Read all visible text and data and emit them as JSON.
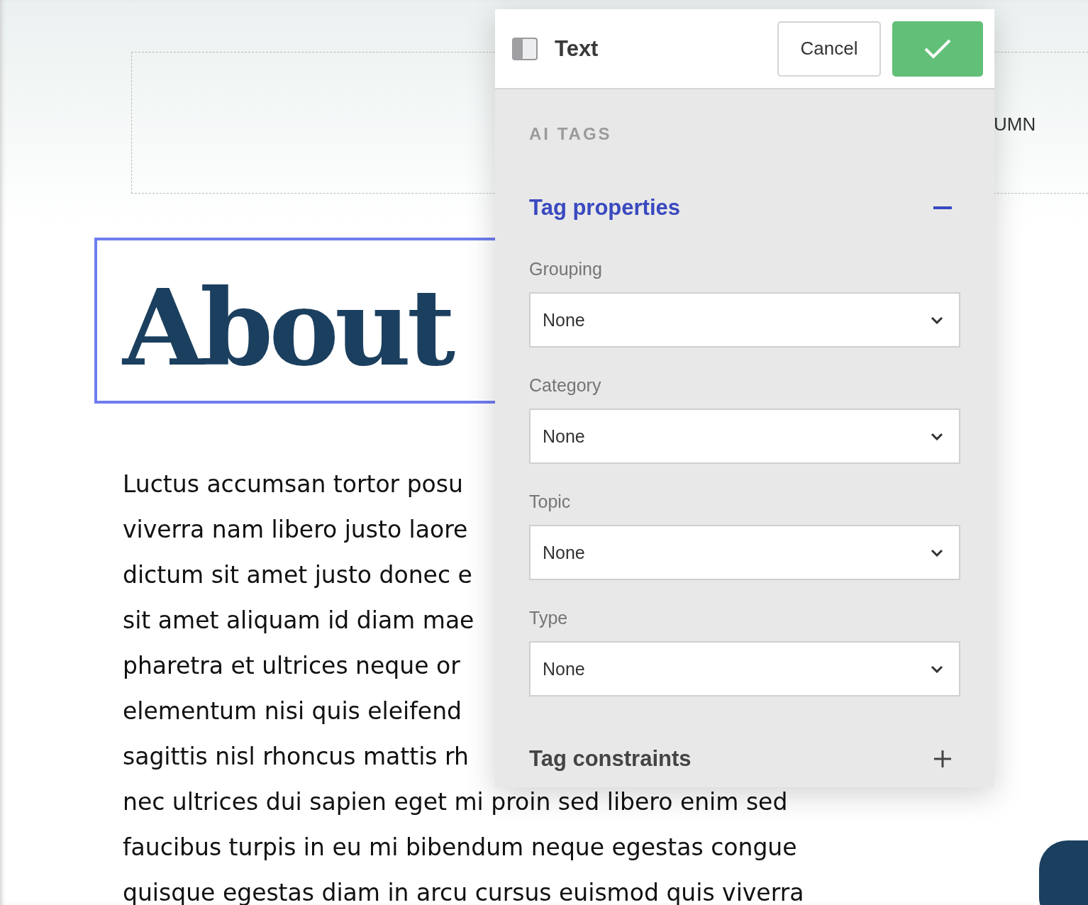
{
  "page": {
    "column_heading": "UMN",
    "heading": "About",
    "paragraph_lines": [
      "Luctus accumsan tortor posu",
      "viverra nam libero justo laore",
      "dictum sit amet justo donec e",
      "sit amet aliquam id diam mae",
      "pharetra et ultrices neque or",
      "elementum nisi quis eleifend",
      "sagittis nisl rhoncus mattis rh",
      "nec ultrices dui sapien eget mi proin sed libero enim sed",
      "faucibus turpis in eu mi bibendum neque egestas congue",
      "quisque egestas diam in arcu cursus euismod quis viverra"
    ]
  },
  "panel": {
    "title": "Text",
    "cancel": "Cancel",
    "section_label": "AI TAGS",
    "sections": [
      {
        "title": "Tag properties",
        "expanded": true,
        "fields": [
          {
            "label": "Grouping",
            "value": "None"
          },
          {
            "label": "Category",
            "value": "None"
          },
          {
            "label": "Topic",
            "value": "None"
          },
          {
            "label": "Type",
            "value": "None"
          }
        ]
      },
      {
        "title": "Tag constraints",
        "expanded": false
      }
    ]
  }
}
